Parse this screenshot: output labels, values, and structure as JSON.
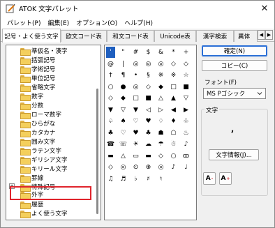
{
  "window": {
    "title": "ATOK 文字パレット",
    "close_glyph": "✕"
  },
  "menu": [
    "パレット(P)",
    "編集(E)",
    "オプション(O)",
    "ヘルプ(H)"
  ],
  "tabs": [
    {
      "label": "記号・よく使う文字",
      "active": true
    },
    {
      "label": "欧文コード表",
      "active": false
    },
    {
      "label": "和文コード表",
      "active": false
    },
    {
      "label": "Unicode表",
      "active": false
    },
    {
      "label": "漢字検索",
      "active": false
    },
    {
      "label": "異体",
      "active": false
    }
  ],
  "tab_scroll": {
    "left": "◀",
    "right": "▶"
  },
  "tree": [
    {
      "label": "準仮名・漢字",
      "level": 2
    },
    {
      "label": "括弧記号",
      "level": 2
    },
    {
      "label": "学術記号",
      "level": 2
    },
    {
      "label": "単位記号",
      "level": 2
    },
    {
      "label": "省略文字",
      "level": 2
    },
    {
      "label": "数字",
      "level": 2
    },
    {
      "label": "分数",
      "level": 2
    },
    {
      "label": "ローマ数字",
      "level": 2
    },
    {
      "label": "ひらがな",
      "level": 2
    },
    {
      "label": "カタカナ",
      "level": 2
    },
    {
      "label": "囲み文字",
      "level": 2
    },
    {
      "label": "ラテン文字",
      "level": 2
    },
    {
      "label": "ギリシア文字",
      "level": 2
    },
    {
      "label": "キリール文字",
      "level": 2
    },
    {
      "label": "罫線",
      "level": 2
    },
    {
      "label": "特殊記号",
      "level": 1,
      "expander": "+"
    },
    {
      "label": "外字",
      "level": 1
    },
    {
      "label": "履歴",
      "level": 1
    },
    {
      "label": "よく使う文字",
      "level": 1
    }
  ],
  "chars": [
    [
      "'",
      "\"",
      "#",
      "$",
      "&",
      "*",
      "+"
    ],
    [
      "@",
      "|",
      "◎",
      "◎",
      "◎",
      "◇",
      "◇"
    ],
    [
      "†",
      "¶",
      "•",
      "§",
      "※",
      "※",
      "☆"
    ],
    [
      "○",
      "●",
      "◎",
      "◇",
      "◆",
      "□",
      "■"
    ],
    [
      "◇",
      "◆",
      "□",
      "■",
      "△",
      "▲",
      "▽"
    ],
    [
      "▼",
      "▽",
      "▼",
      "◁",
      "▷",
      "◀",
      "▶"
    ],
    [
      "♤",
      "♠",
      "♡",
      "♥",
      "♢",
      "♦",
      "♧"
    ],
    [
      "♣",
      "♡",
      "♥",
      "♣",
      "☗",
      "☖",
      "♨"
    ],
    [
      "☎",
      "☏",
      "☀",
      "☁",
      "☂",
      "☃",
      "♪"
    ],
    [
      "▬",
      "△",
      "▭",
      "▬",
      "◇",
      "○",
      "ꝏ"
    ],
    [
      "◇",
      "◎",
      "⊙",
      "⊕",
      "◎",
      "♪",
      "♩"
    ],
    [
      "♫",
      "♬",
      "♭",
      "♯",
      "♮",
      "",
      ""
    ]
  ],
  "buttons": {
    "confirm": "確定(N)",
    "copy": "コピー(C)",
    "char_info": "文字情報(J)..."
  },
  "font": {
    "label": "フォント(F)",
    "value": "MS Pゴシック"
  },
  "preview": {
    "label": "文字",
    "char": ","
  },
  "size_buttons": [
    {
      "glyph": "A",
      "sign": "-"
    },
    {
      "glyph": "A",
      "sign": "+"
    }
  ]
}
